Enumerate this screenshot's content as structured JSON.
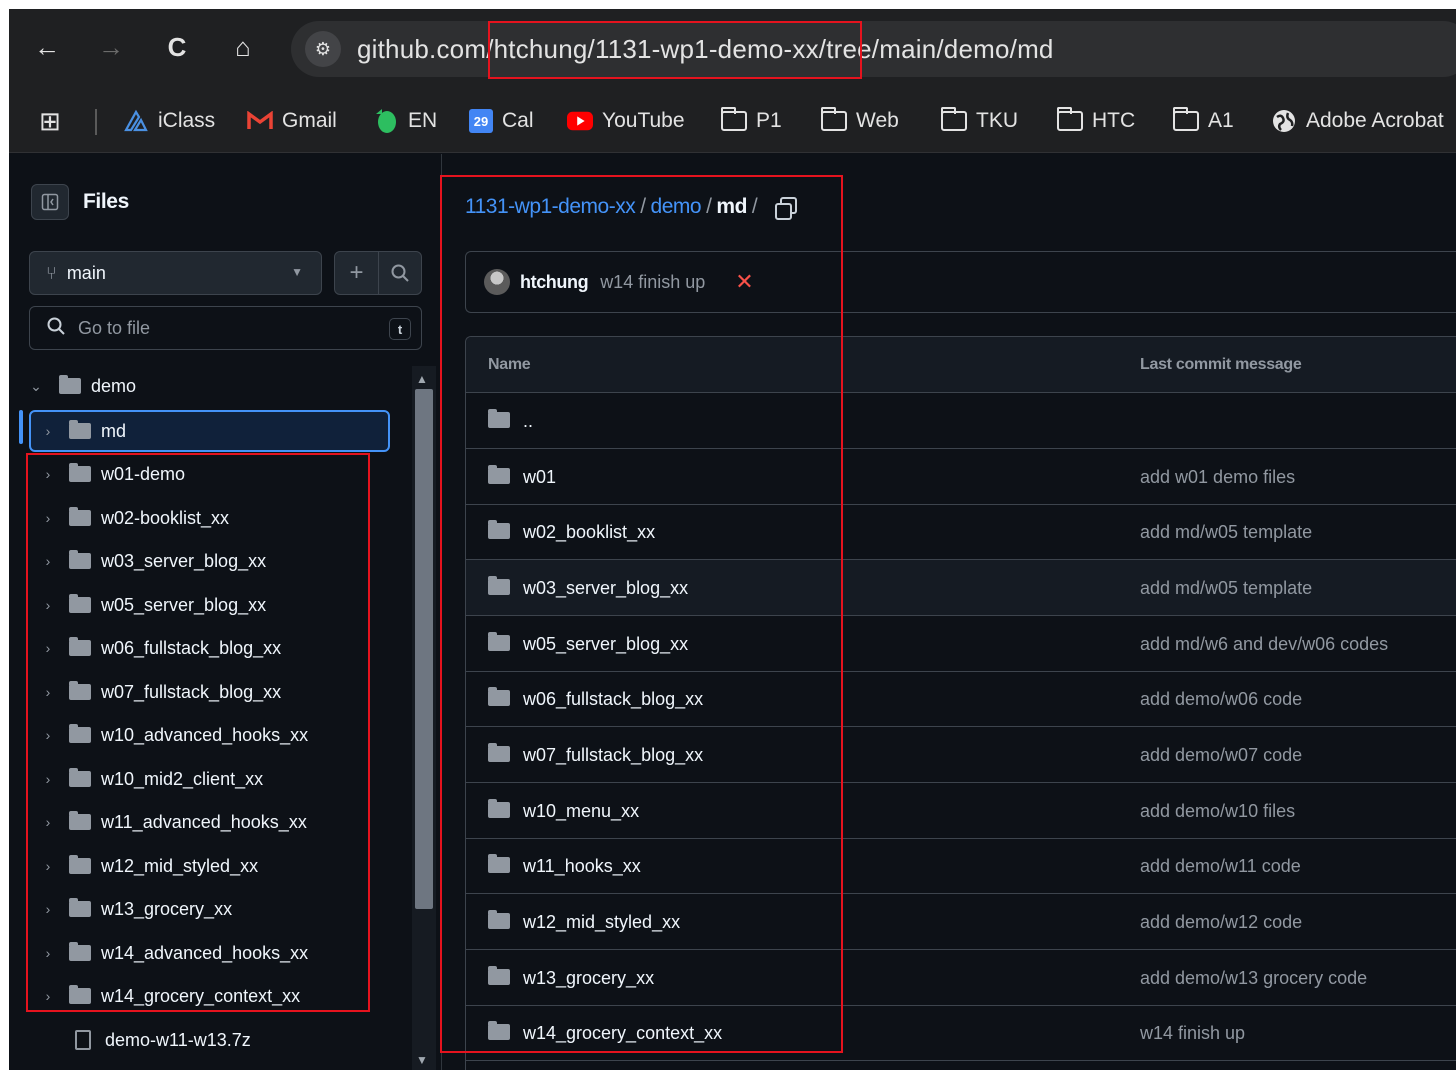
{
  "browser": {
    "back_icon": "←",
    "forward_icon": "→",
    "reload_icon": "C",
    "home_icon": "⌂",
    "site_info_icon": "⚙",
    "url_host": "github.com",
    "url_path": "/htchung/1131-wp1-demo-xx/tree/main/demo/md"
  },
  "bookmarks": {
    "apps_icon": "⊞",
    "items": [
      {
        "label": "iClass",
        "icon": "iclass-icon"
      },
      {
        "label": "Gmail",
        "icon": "gmail-icon"
      },
      {
        "label": "EN",
        "icon": "evernote-icon"
      },
      {
        "label": "Cal",
        "icon": "calendar-icon",
        "badge": "29"
      },
      {
        "label": "YouTube",
        "icon": "youtube-icon"
      },
      {
        "label": "P1",
        "icon": "folder-icon"
      },
      {
        "label": "Web",
        "icon": "folder-icon"
      },
      {
        "label": "TKU",
        "icon": "folder-icon"
      },
      {
        "label": "HTC",
        "icon": "folder-icon"
      },
      {
        "label": "A1",
        "icon": "folder-icon"
      },
      {
        "label": "Adobe Acrobat",
        "icon": "globe-icon"
      }
    ],
    "colors": {
      "gmail": "#ea4335",
      "evernote": "#2dbe60",
      "calendar": "#4285f4",
      "youtube": "#ff0000",
      "iclass": "#4a90e2"
    }
  },
  "sidebar": {
    "title": "Files",
    "branch": "main",
    "goto_placeholder": "Go to file",
    "goto_shortcut": "t",
    "tree": [
      {
        "name": "demo",
        "type": "folder",
        "expanded": true,
        "depth": 0
      },
      {
        "name": "md",
        "type": "folder",
        "depth": 1,
        "selected": true
      },
      {
        "name": "w01-demo",
        "type": "folder",
        "depth": 1
      },
      {
        "name": "w02-booklist_xx",
        "type": "folder",
        "depth": 1
      },
      {
        "name": "w03_server_blog_xx",
        "type": "folder",
        "depth": 1
      },
      {
        "name": "w05_server_blog_xx",
        "type": "folder",
        "depth": 1
      },
      {
        "name": "w06_fullstack_blog_xx",
        "type": "folder",
        "depth": 1
      },
      {
        "name": "w07_fullstack_blog_xx",
        "type": "folder",
        "depth": 1
      },
      {
        "name": "w10_advanced_hooks_xx",
        "type": "folder",
        "depth": 1
      },
      {
        "name": "w10_mid2_client_xx",
        "type": "folder",
        "depth": 1
      },
      {
        "name": "w11_advanced_hooks_xx",
        "type": "folder",
        "depth": 1
      },
      {
        "name": "w12_mid_styled_xx",
        "type": "folder",
        "depth": 1
      },
      {
        "name": "w13_grocery_xx",
        "type": "folder",
        "depth": 1
      },
      {
        "name": "w14_advanced_hooks_xx",
        "type": "folder",
        "depth": 1
      },
      {
        "name": "w14_grocery_context_xx",
        "type": "folder",
        "depth": 1
      },
      {
        "name": "demo-w11-w13.7z",
        "type": "file",
        "depth": 1
      }
    ]
  },
  "main": {
    "breadcrumb": {
      "repo": "1131-wp1-demo-xx",
      "sep": "/",
      "folder": "demo",
      "current": "md",
      "trailing": "/"
    },
    "commit": {
      "author": "htchung",
      "message": "w14 finish up",
      "status": "✕"
    },
    "table": {
      "col_name": "Name",
      "col_message": "Last commit message",
      "rows": [
        {
          "name": "..",
          "message": ""
        },
        {
          "name": "w01",
          "message": "add w01 demo files"
        },
        {
          "name": "w02_booklist_xx",
          "message": "add md/w05 template"
        },
        {
          "name": "w03_server_blog_xx",
          "message": "add md/w05 template"
        },
        {
          "name": "w05_server_blog_xx",
          "message": "add md/w6 and dev/w06 codes"
        },
        {
          "name": "w06_fullstack_blog_xx",
          "message": "add demo/w06 code"
        },
        {
          "name": "w07_fullstack_blog_xx",
          "message": "add demo/w07 code"
        },
        {
          "name": "w10_menu_xx",
          "message": "add demo/w10 files"
        },
        {
          "name": "w11_hooks_xx",
          "message": "add demo/w11 code"
        },
        {
          "name": "w12_mid_styled_xx",
          "message": "add demo/w12 code"
        },
        {
          "name": "w13_grocery_xx",
          "message": "add demo/w13 grocery code"
        },
        {
          "name": "w14_grocery_context_xx",
          "message": "w14 finish up"
        }
      ]
    }
  },
  "annotation_color": "#e5131e"
}
